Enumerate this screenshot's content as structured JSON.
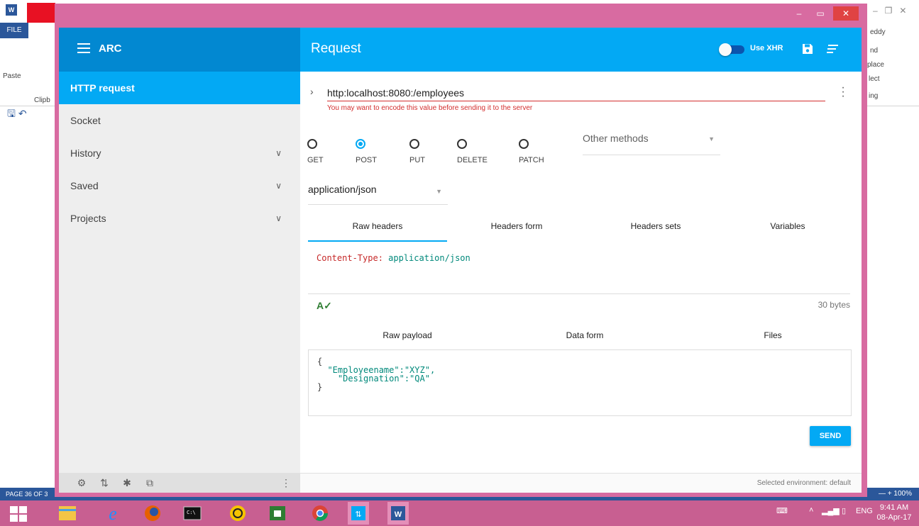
{
  "word": {
    "file_label": "FILE",
    "paste_label": "Paste",
    "clipboard_label": "Clipb",
    "user_label": "eddy",
    "ribbon_right": [
      "nd",
      "place",
      "lect",
      "ing"
    ],
    "page_status": "PAGE 36 OF 3",
    "zoom": "100%",
    "status_color": "#2b579a"
  },
  "app": {
    "title": "ARC",
    "toolbar_title": "Request",
    "use_xhr_label": "Use XHR",
    "accent": "#03a9f4",
    "dark_accent": "#0288d1"
  },
  "drawer": {
    "items": [
      {
        "label": "HTTP request",
        "active": true
      },
      {
        "label": "Socket"
      },
      {
        "label": "History",
        "expandable": true
      },
      {
        "label": "Saved",
        "expandable": true
      },
      {
        "label": "Projects",
        "expandable": true
      }
    ]
  },
  "request": {
    "url": "http:localhost:8080:/employees",
    "url_warning": "You may want to encode this value before sending it to the server",
    "methods": [
      "GET",
      "POST",
      "PUT",
      "DELETE",
      "PATCH"
    ],
    "selected_method": "POST",
    "other_methods_label": "Other methods",
    "content_type": "application/json",
    "header_tabs": [
      "Raw headers",
      "Headers form",
      "Headers sets",
      "Variables"
    ],
    "raw_header_key": "Content-Type:",
    "raw_header_value": "application/json",
    "payload_size": "30 bytes",
    "payload_tabs": [
      "Raw payload",
      "Data form",
      "Files"
    ],
    "payload_lines": [
      "{",
      "  \"Employeename\":\"XYZ\",",
      "    \"Designation\":\"QA\"",
      "}"
    ],
    "send_label": "SEND",
    "environment": "Selected environment: default"
  },
  "taskbar": {
    "lang": "ENG",
    "time": "9:41 AM",
    "date": "08-Apr-17"
  }
}
